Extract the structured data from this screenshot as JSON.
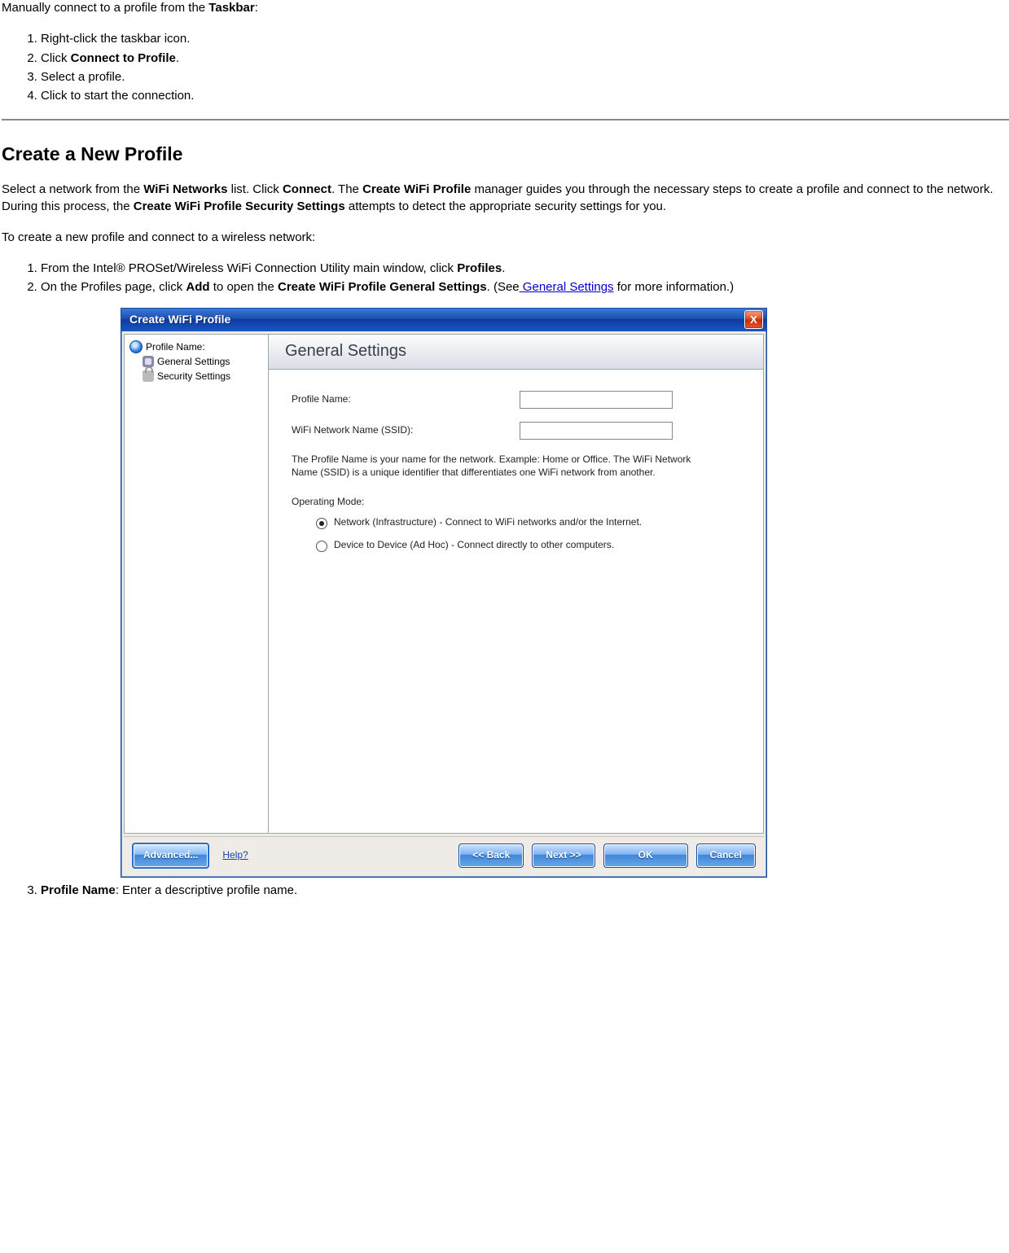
{
  "intro": {
    "manual_connect_pre": "Manually connect to a profile from the ",
    "manual_connect_bold": "Taskbar",
    "manual_connect_post": ":"
  },
  "taskbar_steps": {
    "s1": "Right-click the taskbar icon.",
    "s2_pre": "Click ",
    "s2_bold": "Connect to Profile",
    "s2_post": ".",
    "s3": "Select a profile.",
    "s4": "Click to start the connection."
  },
  "heading": "Create a New Profile",
  "para1": {
    "t1": "Select a network from the ",
    "b1": "WiFi Networks",
    "t2": " list. Click ",
    "b2": "Connect",
    "t3": ". The ",
    "b3": "Create WiFi Profile",
    "t4": " manager guides you through the necessary steps to create a profile and connect to the network. During this process, the ",
    "b4": "Create WiFi Profile Security Settings",
    "t5": " attempts to detect the appropriate security settings for you."
  },
  "para2": "To create a new profile and connect to a wireless network:",
  "steps2": {
    "s1_pre": "From the Intel® PROSet/Wireless WiFi Connection Utility main window, click ",
    "s1_bold": "Profiles",
    "s1_post": ".",
    "s2_pre": "On the Profiles page, click ",
    "s2_b1": "Add",
    "s2_mid": " to open the ",
    "s2_b2": "Create WiFi Profile General Settings",
    "s2_post1": ". (See",
    "s2_link": " General Settings",
    "s2_post2": " for more information.)",
    "s3_b": "Profile Name",
    "s3_post": ": Enter a descriptive profile name."
  },
  "dialog": {
    "title": "Create WiFi Profile",
    "close": "X",
    "tree": {
      "root": "Profile Name:",
      "item1": "General Settings",
      "item2": "Security Settings"
    },
    "header": "General Settings",
    "profile_name_label": "Profile Name:",
    "ssid_label": "WiFi Network Name (SSID):",
    "note": "The Profile Name is your name for the network. Example: Home or Office. The WiFi Network Name (SSID) is a unique identifier that differentiates one WiFi network from another.",
    "opmode_label": "Operating Mode:",
    "radio1": "Network (Infrastructure) - Connect to WiFi networks and/or the Internet.",
    "radio2": "Device to Device (Ad Hoc) - Connect directly to other computers.",
    "buttons": {
      "advanced": "Advanced...",
      "help": "Help?",
      "back": "<< Back",
      "next": "Next >>",
      "ok": "OK",
      "cancel": "Cancel"
    }
  }
}
